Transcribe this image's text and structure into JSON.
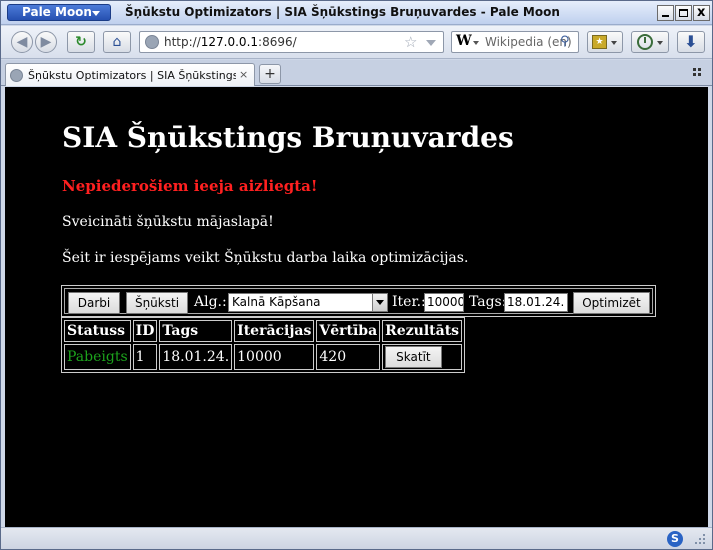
{
  "browser": {
    "app_menu_label": "Pale Moon",
    "window_title": "Šņūkstu Optimizators | SIA Šņūkstings Bruņuvardes - Pale Moon",
    "close_glyph": "x",
    "url_prefix": "http://",
    "url_host": "127.0.0.1",
    "url_rest": ":8696/",
    "search_engine_glyph": "W",
    "search_placeholder": "Wikipedia (en)",
    "tab_title": "Šņūkstu Optimizators | SIA Šņūkstings Br...",
    "tab_close": "×",
    "new_tab": "+",
    "status_icon_letter": "S",
    "icons": [
      "back-icon",
      "forward-icon",
      "reload-icon",
      "home-icon",
      "globe-icon",
      "star-icon",
      "search-icon",
      "bookmarks-icon",
      "history-icon",
      "download-icon",
      "tab-list-icon"
    ]
  },
  "page": {
    "heading": "SIA Šņūkstings Bruņuvardes",
    "warning": "Nepiederošiem ieeja aizliegta!",
    "welcome": "Sveicināti šņūkstu mājaslapā!",
    "intro": "Šeit ir iespējams veikt Šņūkstu darba laika optimizācijas.",
    "colors": {
      "warning": "#ff2020",
      "status_ok": "#1ca21c",
      "background": "#000000"
    }
  },
  "controls": {
    "jobs_button": "Darbi",
    "snuksti_button": "Šņūksti",
    "alg_label": "Alg.:",
    "alg_selected": "Kalnā Kāpšana",
    "iter_label": "Iter.:",
    "iter_value": "10000",
    "tags_label": "Tags:",
    "tags_value": "18.01.24.",
    "optimize_button": "Optimizēt"
  },
  "results": {
    "headers": [
      "Statuss",
      "ID",
      "Tags",
      "Iterācijas",
      "Vērtība",
      "Rezultāts"
    ],
    "rows": [
      {
        "status": "Pabeigts",
        "id": "1",
        "tag": "18.01.24.",
        "iterations": "10000",
        "value": "420",
        "action": "Skatīt"
      }
    ]
  }
}
